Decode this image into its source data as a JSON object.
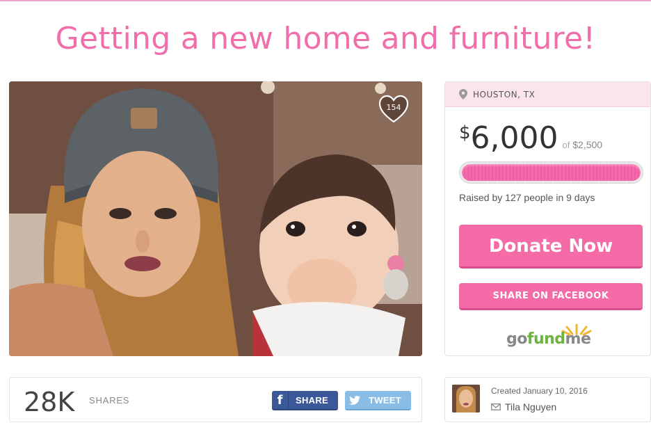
{
  "campaign": {
    "title": "Getting a new home and furniture!",
    "heart_count": "154"
  },
  "panel": {
    "location": "HOUSTON, TX",
    "currency_symbol": "$",
    "raised_amount": "6,000",
    "goal_prefix": "of",
    "goal_amount": "$2,500",
    "progress_fraction": 1.0,
    "raised_text_prefix": "Raised by ",
    "people_count": "127",
    "raised_text_middle": " people in ",
    "days_count": "9",
    "raised_text_suffix": " days",
    "donate_label": "Donate Now",
    "facebook_share_label": "SHARE ON FACEBOOK",
    "logo": {
      "go": "go",
      "fund": "fund",
      "me": "me"
    }
  },
  "shares": {
    "count": "28K",
    "label": "SHARES",
    "share_button": "SHARE",
    "tweet_button": "TWEET"
  },
  "organizer": {
    "created": "Created January 10, 2016",
    "name": "Tila Nguyen"
  },
  "colors": {
    "accent_pink": "#f06eaa",
    "button_pink": "#f46ba8",
    "facebook_blue": "#3b5998",
    "twitter_blue": "#89bde6",
    "gofundme_green": "#6cb33f"
  },
  "icons": {
    "location": "map-pin-icon",
    "heart": "heart-icon",
    "facebook": "facebook-icon",
    "twitter": "twitter-bird-icon",
    "email": "envelope-icon"
  }
}
